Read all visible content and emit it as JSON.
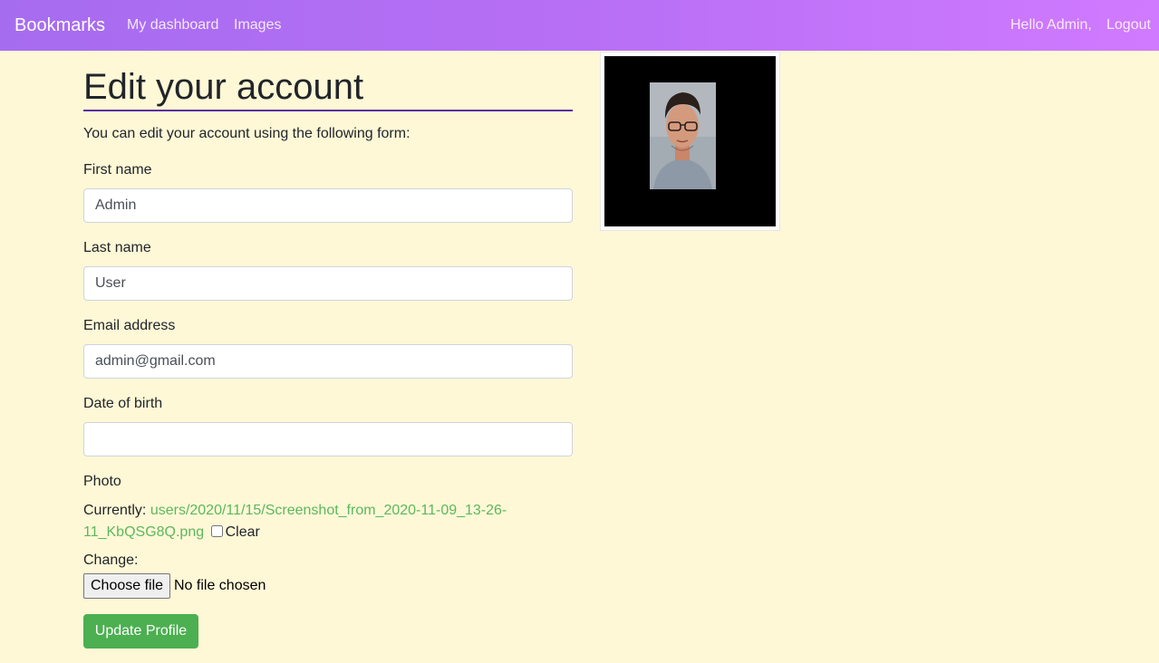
{
  "navbar": {
    "brand": "Bookmarks",
    "links": [
      {
        "label": "My dashboard"
      },
      {
        "label": "Images"
      }
    ],
    "greeting": "Hello Admin,",
    "logout": "Logout"
  },
  "page": {
    "title": "Edit your account",
    "intro": "You can edit your account using the following form:"
  },
  "form": {
    "first_name": {
      "label": "First name",
      "value": "Admin"
    },
    "last_name": {
      "label": "Last name",
      "value": "User"
    },
    "email": {
      "label": "Email address",
      "value": "admin@gmail.com"
    },
    "date_of_birth": {
      "label": "Date of birth",
      "value": ""
    },
    "photo": {
      "label": "Photo",
      "currently_label": "Currently:",
      "current_file": "users/2020/11/15/Screenshot_from_2020-11-09_13-26-11_KbQSG8Q.png",
      "clear_label": "Clear",
      "change_label": "Change:",
      "choose_button": "Choose file",
      "file_status": "No file chosen"
    },
    "submit": "Update Profile"
  },
  "colors": {
    "background": "#fff8d7",
    "navbar_start": "#a66cf0",
    "navbar_end": "#d07aff",
    "link": "#5cb85c",
    "submit": "#4caf50"
  }
}
